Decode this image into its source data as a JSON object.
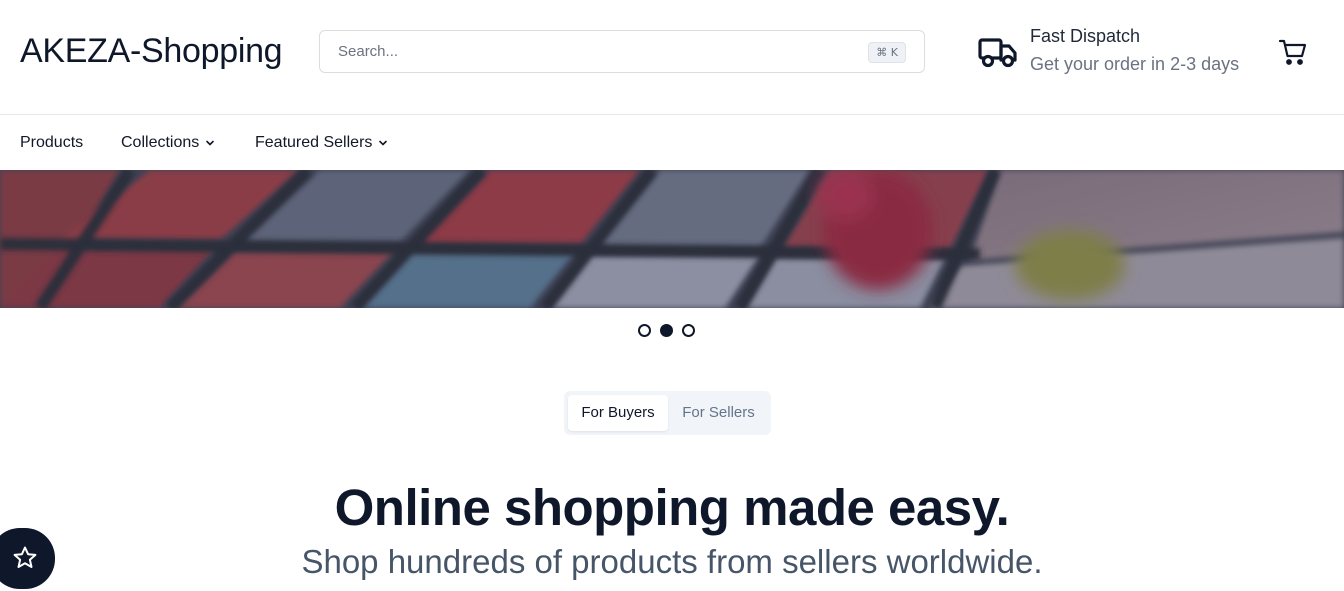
{
  "brand": {
    "name": "AKEZA-Shopping"
  },
  "search": {
    "placeholder": "Search...",
    "value": "",
    "shortcut": "⌘ K"
  },
  "dispatch": {
    "title": "Fast Dispatch",
    "subtitle": "Get your order in 2-3 days",
    "icon": "truck-icon"
  },
  "cart": {
    "icon": "cart-icon"
  },
  "nav": {
    "items": [
      {
        "label": "Products",
        "has_dropdown": false
      },
      {
        "label": "Collections",
        "has_dropdown": true
      },
      {
        "label": "Featured Sellers",
        "has_dropdown": true
      }
    ]
  },
  "carousel": {
    "slide_count": 3,
    "active_index": 1
  },
  "audience_tabs": {
    "buyers": "For Buyers",
    "sellers": "For Sellers",
    "active": "buyers"
  },
  "hero_text": {
    "headline": "Online shopping made easy.",
    "subheadline": "Shop hundreds of products from sellers worldwide."
  },
  "fab": {
    "icon": "star-icon"
  },
  "colors": {
    "primary": "#0f172a",
    "muted": "#64748b",
    "border": "#e5e7eb"
  }
}
